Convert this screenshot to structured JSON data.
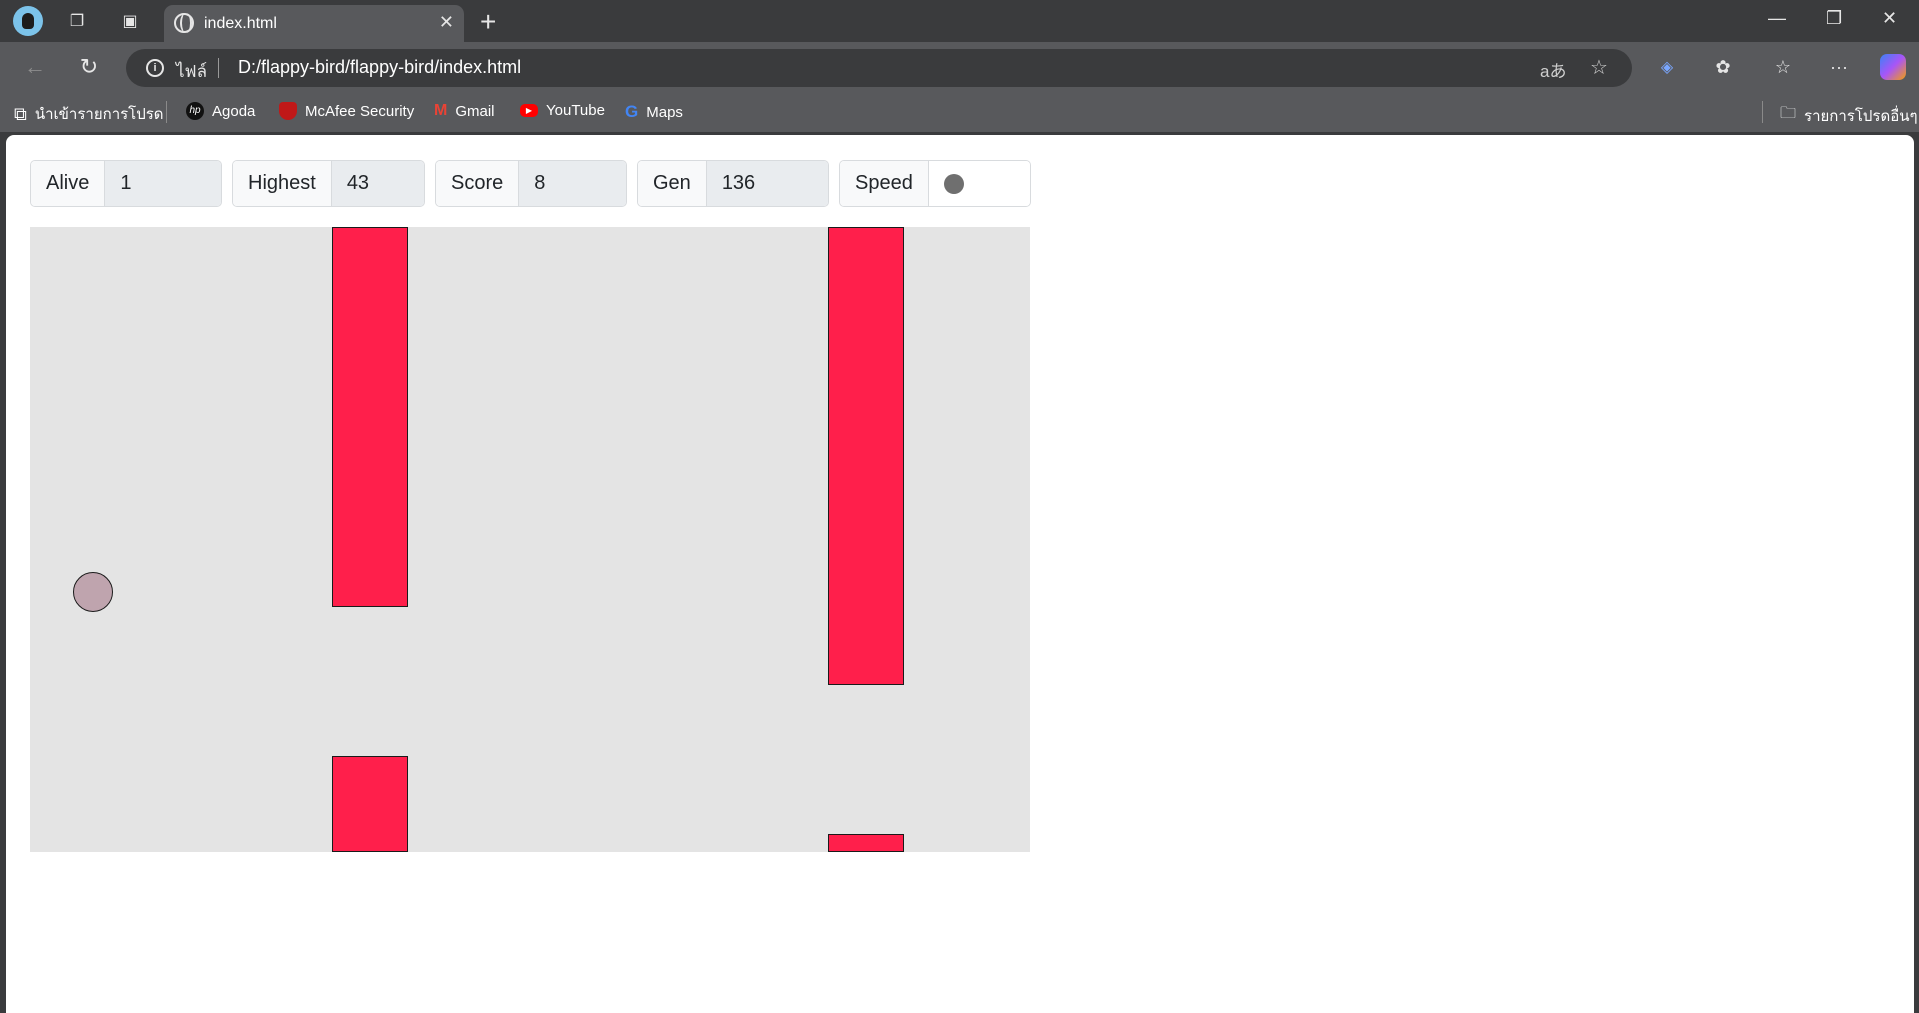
{
  "browser": {
    "tab_title": "index.html",
    "address_label": "ไฟล์",
    "url": "D:/flappy-bird/flappy-bird/index.html",
    "read_aloud_glyph": "aあ"
  },
  "bookmarks": [
    {
      "label": "นำเข้ารายการโปรด",
      "icon": "import-icon"
    },
    {
      "label": "Agoda",
      "icon": "hp-icon"
    },
    {
      "label": "McAfee Security",
      "icon": "mcafee-icon",
      "color": "#c01818"
    },
    {
      "label": "Gmail",
      "icon": "gmail-icon",
      "color": "#ea4335"
    },
    {
      "label": "YouTube",
      "icon": "youtube-icon",
      "color": "#ff0000"
    },
    {
      "label": "Maps",
      "icon": "google-icon",
      "color": "#4285f4"
    }
  ],
  "other_favorites": "รายการโปรดอื่นๆ",
  "stats": {
    "alive_label": "Alive",
    "alive_value": "1",
    "highest_label": "Highest",
    "highest_value": "43",
    "score_label": "Score",
    "score_value": "8",
    "gen_label": "Gen",
    "gen_value": "136",
    "speed_label": "Speed"
  },
  "colors": {
    "pipe": "#ff1f4b",
    "bird": "#bfa4ae",
    "game_bg": "#e4e4e4"
  }
}
